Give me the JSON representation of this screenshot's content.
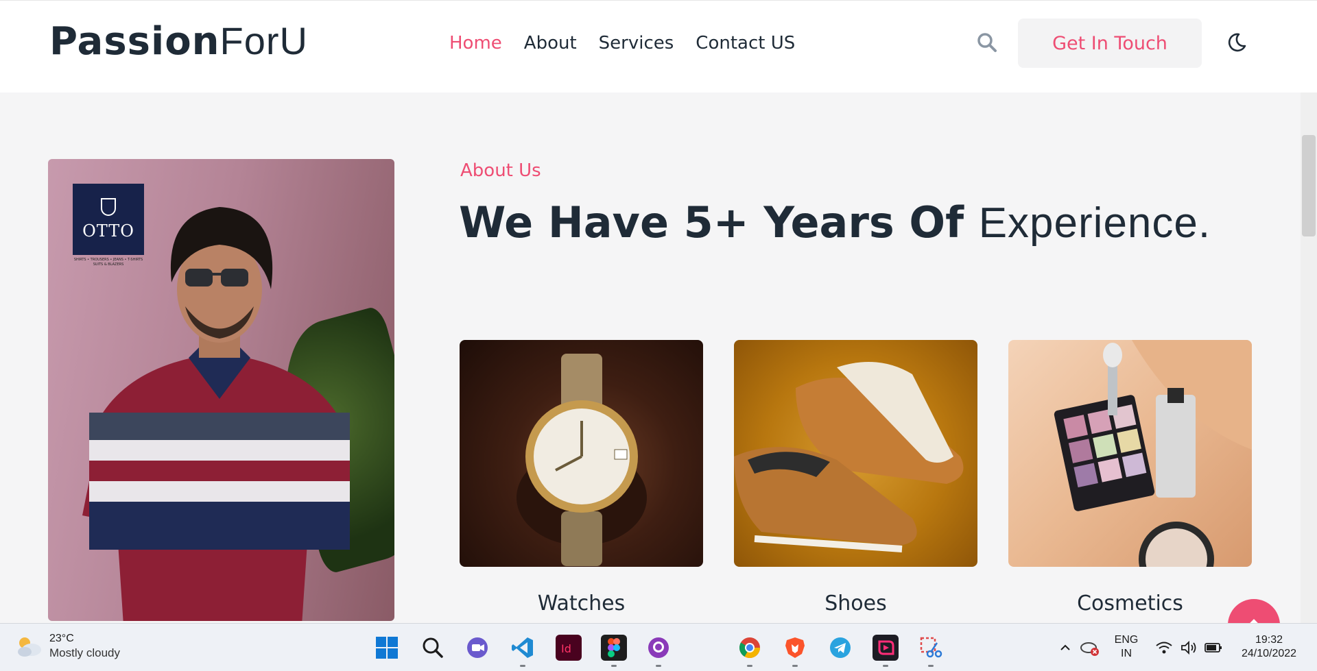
{
  "header": {
    "logo_bold": "Passion",
    "logo_thin": "ForU",
    "nav": [
      {
        "label": "Home",
        "active": true
      },
      {
        "label": "About",
        "active": false
      },
      {
        "label": "Services",
        "active": false
      },
      {
        "label": "Contact US",
        "active": false
      }
    ],
    "cta_label": "Get In Touch"
  },
  "colors": {
    "accent": "#ee4d73",
    "text_dark": "#1f2b37",
    "background": "#f5f5f6"
  },
  "hero": {
    "brand_name": "OTTO",
    "brand_tagline": "SHIRTS • TROUSERS • JEANS • T-SHIRTS SUITS & BLAZERS"
  },
  "about": {
    "label": "About Us",
    "heading_bold": "We Have 5+ Years Of",
    "heading_light": "Experience."
  },
  "categories": [
    {
      "label": "Watches",
      "icon": "watch-image"
    },
    {
      "label": "Shoes",
      "icon": "shoes-image"
    },
    {
      "label": "Cosmetics",
      "icon": "cosmetics-image"
    }
  ],
  "taskbar": {
    "weather_temp": "23°C",
    "weather_desc": "Mostly cloudy",
    "apps": [
      "windows-start",
      "search",
      "teams-chat",
      "vscode",
      "indesign",
      "figma",
      "github-desktop",
      "chrome",
      "brave",
      "telegram",
      "app-pink",
      "snipping-tool"
    ],
    "language_line1": "ENG",
    "language_line2": "IN",
    "time": "19:32",
    "date": "24/10/2022"
  }
}
